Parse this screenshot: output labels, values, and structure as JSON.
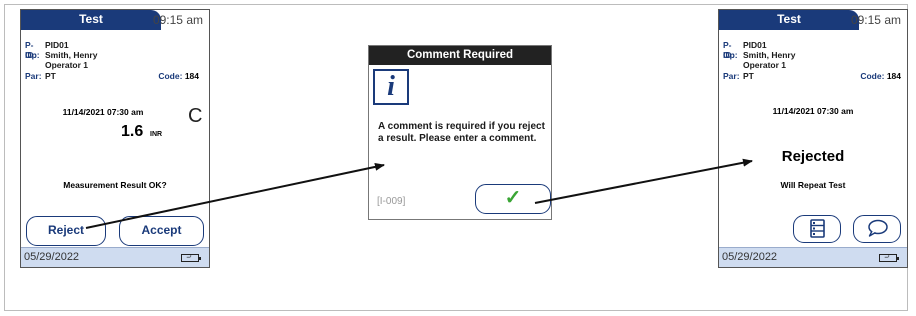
{
  "screen1": {
    "header": {
      "title": "Test",
      "time": "09:15 am"
    },
    "info": {
      "pid_label": "P-ID:",
      "pid_value": "PID01",
      "op_label": "Op:",
      "op_value_line1": "Smith, Henry",
      "op_value_line2": "Operator 1",
      "par_label": "Par:",
      "par_value": "PT",
      "code_label": "Code:",
      "code_value": "184"
    },
    "datetime": "11/14/2021 07:30 am",
    "result_value": "1.6",
    "result_unit": "INR",
    "cursor_text": "C",
    "message": "Measurement Result OK?",
    "reject_label": "Reject",
    "accept_label": "Accept",
    "footer_date": "05/29/2022"
  },
  "dialog": {
    "title": "Comment Required",
    "icon": "info-icon",
    "icon_glyph": "i",
    "message": "A comment is required if you reject a result. Please enter a comment.",
    "code": "[I-009]",
    "ok_glyph": "✓"
  },
  "screen2": {
    "header": {
      "title": "Test",
      "time": "09:15 am"
    },
    "info": {
      "pid_label": "P-ID:",
      "pid_value": "PID01",
      "op_label": "Op:",
      "op_value_line1": "Smith, Henry",
      "op_value_line2": "Operator 1",
      "par_label": "Par:",
      "par_value": "PT",
      "code_label": "Code:",
      "code_value": "184"
    },
    "datetime": "11/14/2021 07:30 am",
    "status": "Rejected",
    "message": "Will Repeat Test",
    "list_icon": "list-icon",
    "comment_icon": "speech-bubble-icon",
    "footer_date": "05/29/2022"
  },
  "colors": {
    "navy": "#1a3a7a",
    "footer": "#cfdcf0",
    "check": "#3aa535",
    "dialog_header": "#222222"
  }
}
